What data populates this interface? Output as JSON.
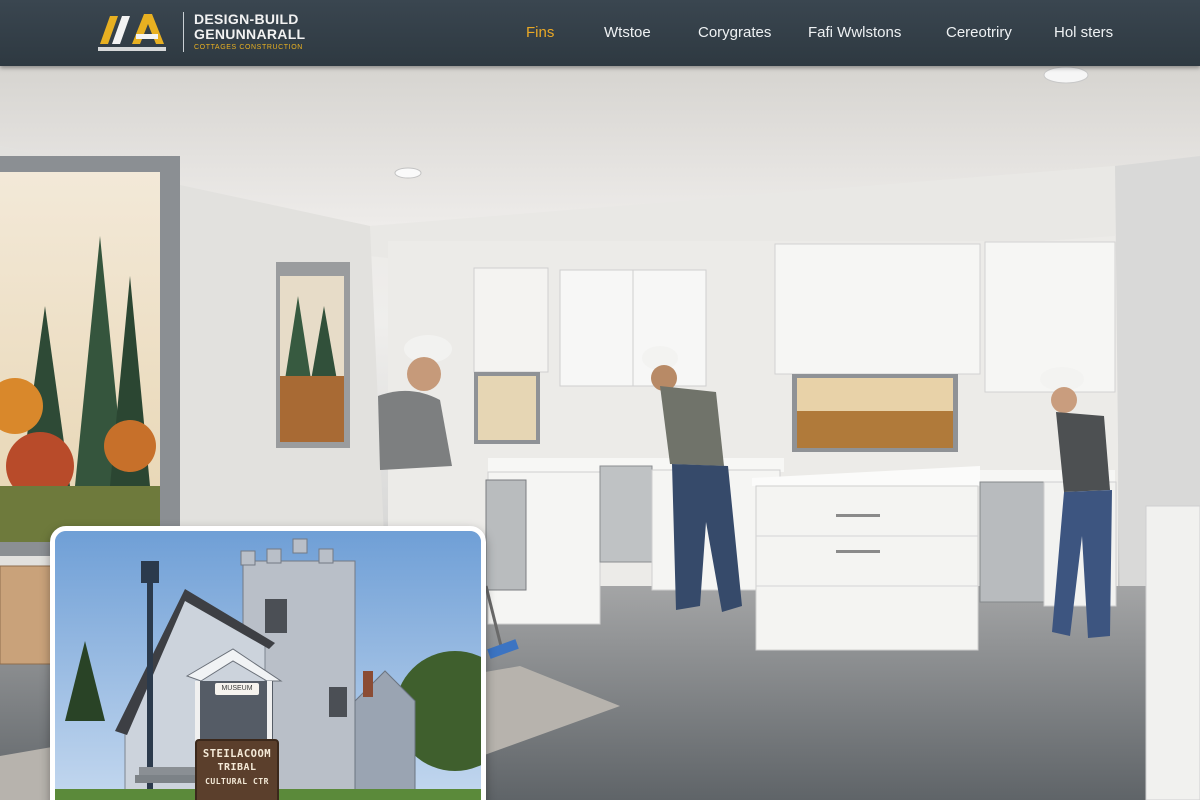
{
  "header": {
    "logo": {
      "icon": "da-monogram-logo",
      "wordmark_line1": "DESIGN-BUILD",
      "wordmark_line2": "GENUNNARALL",
      "wordmark_line3": "COTTAGES CONSTRUCTION"
    },
    "nav": [
      {
        "label": "Fins",
        "active": true
      },
      {
        "label": "Wtstoe",
        "active": false
      },
      {
        "label": "Corygrates",
        "active": false
      },
      {
        "label": "Fafi Wwlstons",
        "active": false
      },
      {
        "label": "Cereotriry",
        "active": false
      },
      {
        "label": "Hol sters",
        "active": false
      }
    ],
    "colors": {
      "background": "#333e47",
      "nav_text": "#eef1f3",
      "active": "#e9a826",
      "accent": "#e8b021"
    }
  },
  "hero": {
    "image": "kitchen-renovation-workers-photo",
    "inset": {
      "image": "museum-building-photo",
      "museum_label": "MUSEUM",
      "sign": {
        "line1": "STEILACOOM",
        "line2": "TRIBAL",
        "line3": "CULTURAL CTR"
      }
    }
  }
}
